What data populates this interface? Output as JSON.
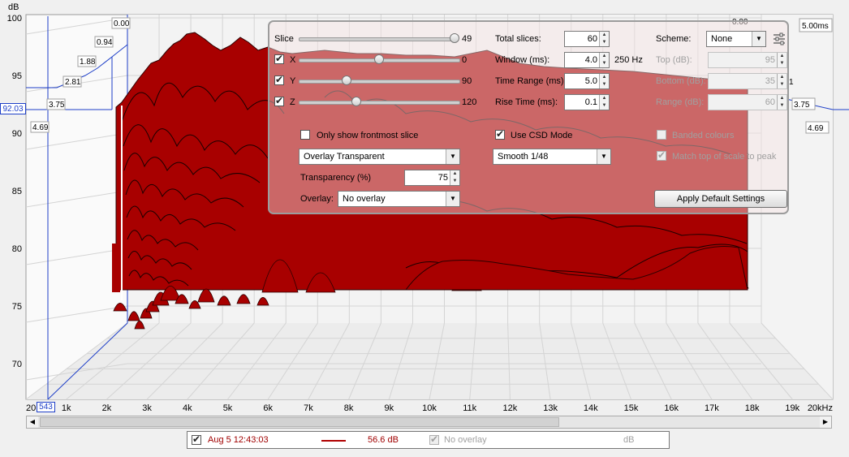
{
  "plot": {
    "y_unit": "dB",
    "y_ticks": [
      "100",
      "95",
      "90",
      "85",
      "80",
      "75",
      "70"
    ],
    "x_ticks": [
      "20",
      "1k",
      "2k",
      "3k",
      "4k",
      "5k",
      "6k",
      "7k",
      "8k",
      "9k",
      "10k",
      "11k",
      "12k",
      "13k",
      "14k",
      "15k",
      "16k",
      "17k",
      "18k",
      "19k",
      "20kHz"
    ],
    "z_ticks_left": [
      "0.00",
      "0.94",
      "1.88",
      "2.81",
      "3.75",
      "4.69"
    ],
    "z_ticks_right": [
      "0.00",
      "3.75",
      "4.69",
      "5.00ms"
    ],
    "right_stub_label": "1",
    "cursor_freq": "543",
    "cursor_db": "92.03",
    "fill_color": "#a80000",
    "axis_color": "#1e3fc8"
  },
  "panel": {
    "slice": {
      "label": "Slice",
      "value": "49"
    },
    "x": {
      "label": "X",
      "value": "0",
      "checked": true
    },
    "y": {
      "label": "Y",
      "value": "90",
      "checked": true
    },
    "z": {
      "label": "Z",
      "value": "120",
      "checked": true
    },
    "total_slices": {
      "label": "Total slices:",
      "value": "60"
    },
    "window": {
      "label": "Window (ms):",
      "value": "4.0",
      "suffix": "250 Hz"
    },
    "time_range": {
      "label": "Time Range (ms):",
      "value": "5.0"
    },
    "rise_time": {
      "label": "Rise Time (ms):",
      "value": "0.1"
    },
    "scheme": {
      "label": "Scheme:",
      "value": "None"
    },
    "top": {
      "label": "Top (dB):",
      "value": "95"
    },
    "bottom": {
      "label": "Bottom (dB):",
      "value": "35"
    },
    "range": {
      "label": "Range (dB):",
      "value": "60"
    },
    "only_frontmost": {
      "label": "Only show  frontmost slice",
      "checked": false
    },
    "use_csd": {
      "label": "Use CSD Mode",
      "checked": true
    },
    "banded": {
      "label": "Banded colours",
      "checked": false
    },
    "match_top": {
      "label": "Match top of scale to peak",
      "checked": true
    },
    "render_mode": {
      "value": "Overlay Transparent"
    },
    "smoothing": {
      "value": "Smooth 1/48"
    },
    "transparency": {
      "label": "Transparency (%)",
      "value": "75"
    },
    "overlay": {
      "label": "Overlay:",
      "value": "No overlay"
    },
    "apply_default": {
      "label": "Apply Default Settings"
    }
  },
  "legend": {
    "measurement": "Aug 5 12:43:03",
    "level": "56.6 dB",
    "overlay_label": "No overlay",
    "overlay_unit": "dB",
    "line_color": "#b00000"
  }
}
